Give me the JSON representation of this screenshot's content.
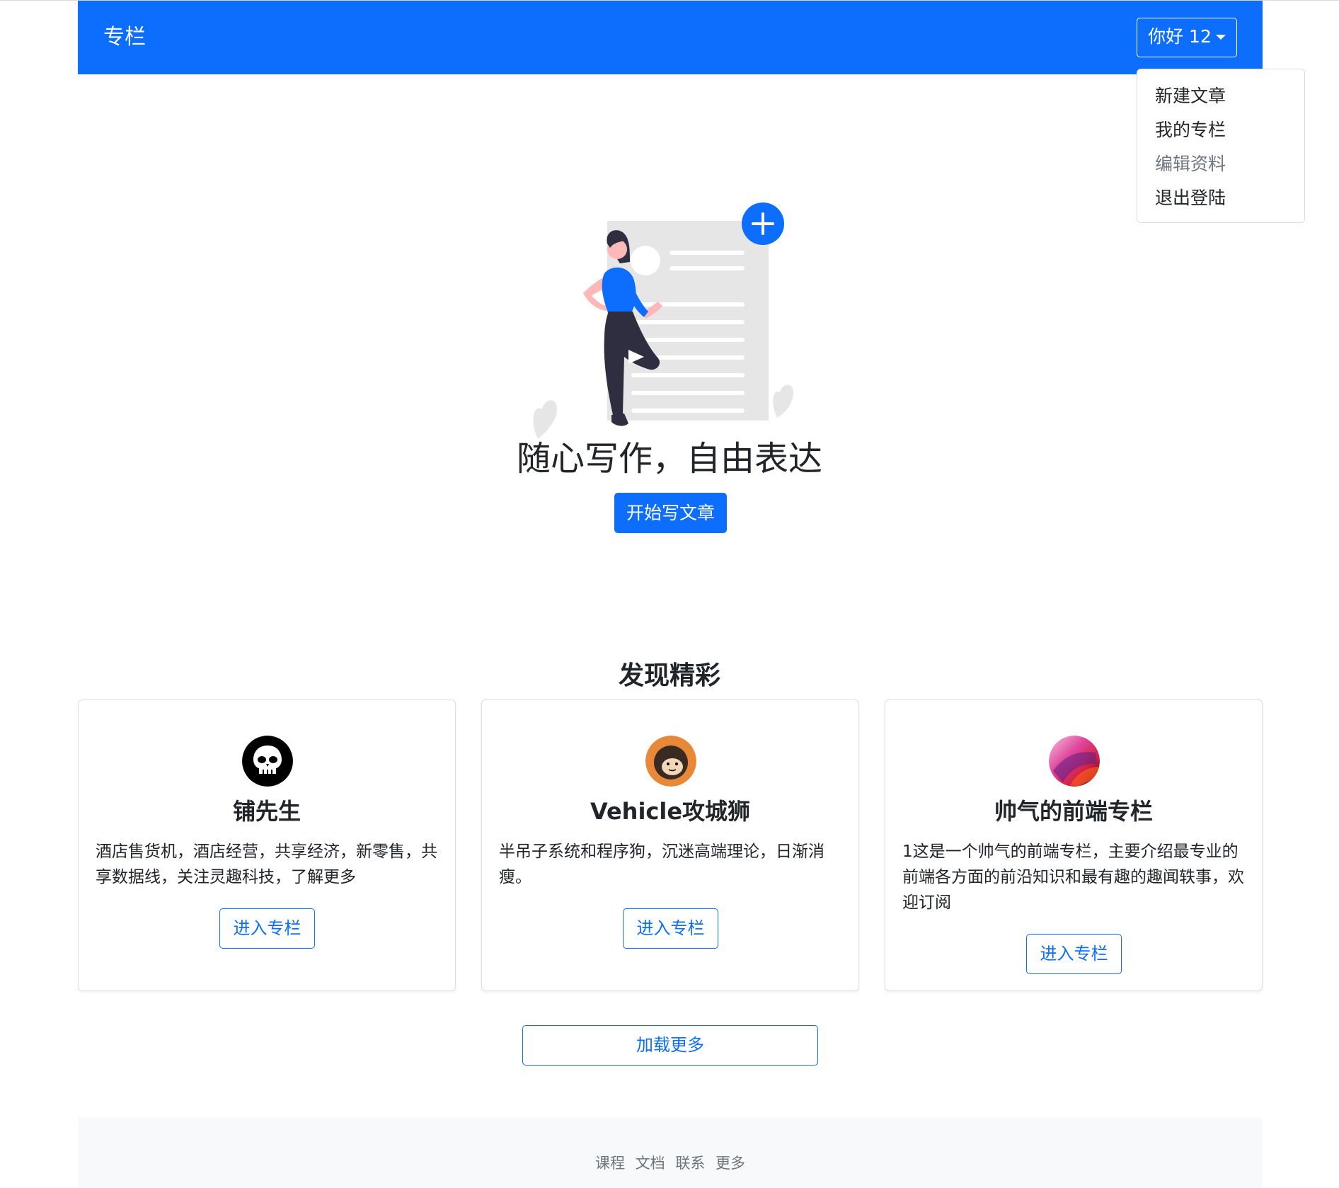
{
  "navbar": {
    "brand": "专栏",
    "user_button": "你好 12"
  },
  "dropdown": {
    "items": [
      "新建文章",
      "我的专栏",
      "编辑资料",
      "退出登陆"
    ]
  },
  "hero": {
    "title": "随心写作，自由表达",
    "button": "开始写文章"
  },
  "section": {
    "title": "发现精彩"
  },
  "cards": [
    {
      "title": "铺先生",
      "text": "酒店售货机，酒店经营，共享经济，新零售，共享数据线，关注灵趣科技，了解更多",
      "button": "进入专栏"
    },
    {
      "title": "Vehicle攻城狮",
      "text": "半吊子系统和程序狗，沉迷高端理论，日渐消瘦。",
      "button": "进入专栏"
    },
    {
      "title": "帅气的前端专栏",
      "text": "1这是一个帅气的前端专栏，主要介绍最专业的前端各方面的前沿知识和最有趣的趣闻轶事，欢迎订阅",
      "button": "进入专栏"
    }
  ],
  "load_more": "加载更多",
  "footer": {
    "links": [
      "课程",
      "文档",
      "联系",
      "更多"
    ]
  },
  "colors": {
    "primary": "#0d6efd",
    "muted": "#6c757d",
    "footer_bg": "#f8f9fa"
  },
  "icons": {
    "avatar_1": "skull-avatar",
    "avatar_2": "cartoon-avatar",
    "avatar_3": "gradient-avatar",
    "hero": "writing-woman-illustration",
    "plus": "plus-icon"
  }
}
